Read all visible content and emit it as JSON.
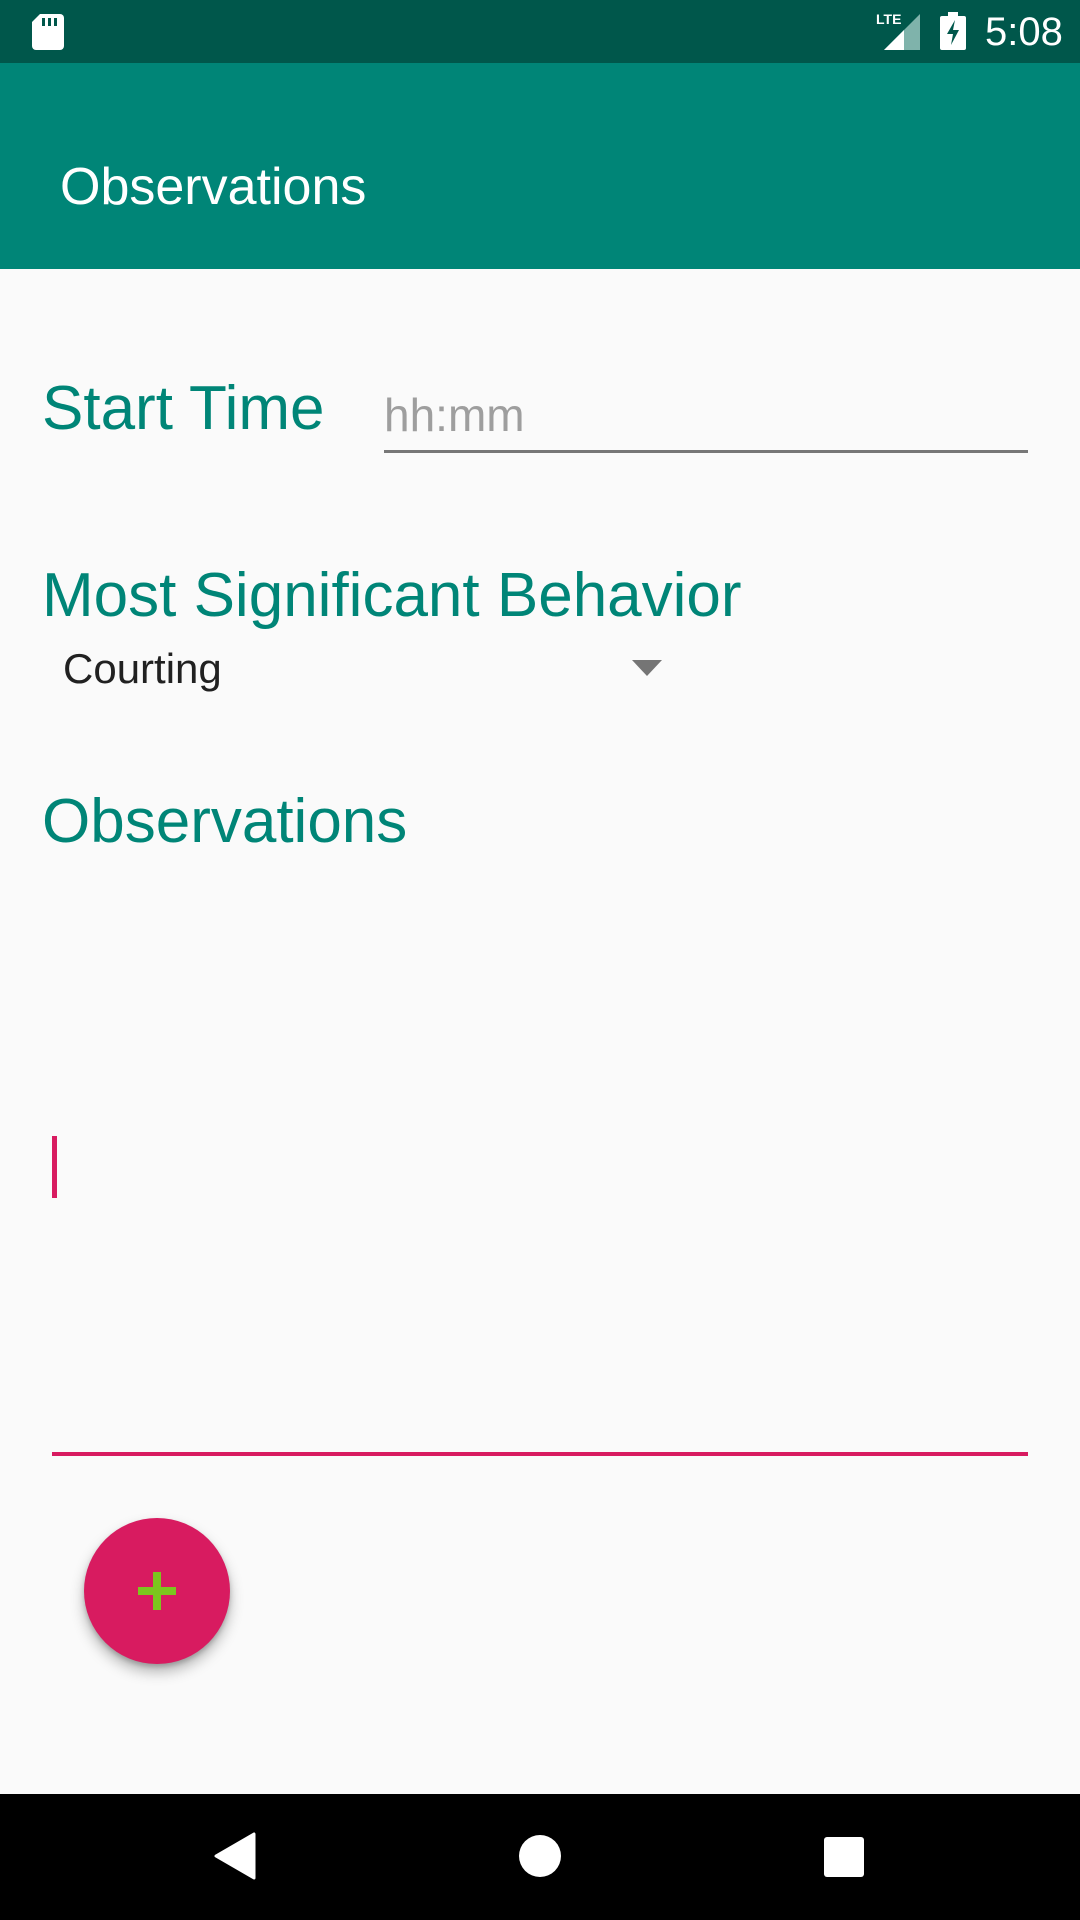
{
  "status_bar": {
    "time": "5:08",
    "network": "LTE",
    "icons": [
      "sd-card-icon",
      "lte-signal-icon",
      "battery-charging-icon"
    ]
  },
  "app_bar": {
    "title": "Observations"
  },
  "form": {
    "start_time": {
      "label": "Start Time",
      "value": "",
      "placeholder": "hh:mm"
    },
    "behavior": {
      "label": "Most Significant Behavior",
      "selected": "Courting"
    },
    "observations": {
      "label": "Observations",
      "value": ""
    }
  },
  "fab": {
    "icon": "plus-icon"
  },
  "nav_bar": {
    "icons": [
      "back-icon",
      "home-icon",
      "recents-icon"
    ]
  },
  "colors": {
    "status_bar": "#00574b",
    "primary": "#008577",
    "accent": "#d81b60",
    "fab_plus": "#7cc61e",
    "background": "#fafafa"
  }
}
